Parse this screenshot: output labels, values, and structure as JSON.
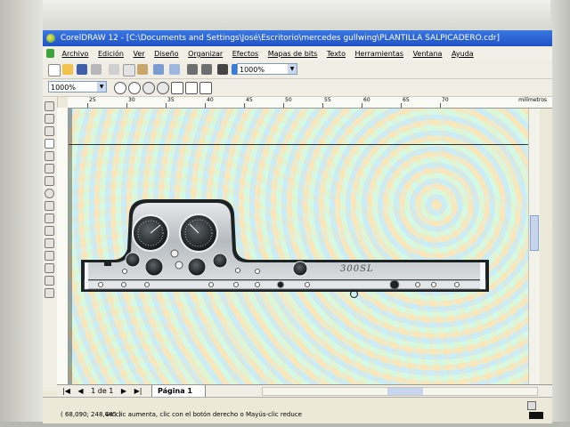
{
  "window": {
    "title": "CorelDRAW 12 - [C:\\Documents and Settings\\José\\Escritorio\\mercedes gullwing\\PLANTILLA SALPICADERO.cdr]"
  },
  "menu": {
    "items": [
      "Archivo",
      "Edición",
      "Ver",
      "Diseño",
      "Organizar",
      "Efectos",
      "Mapas de bits",
      "Texto",
      "Herramientas",
      "Ventana",
      "Ayuda"
    ]
  },
  "toolbar": {
    "zoom_value": "1000%",
    "zoom_level_value": "1000%"
  },
  "ruler": {
    "ticks": [
      "25",
      "30",
      "35",
      "40",
      "45",
      "50",
      "55",
      "60",
      "65",
      "70"
    ],
    "units": "milímetros"
  },
  "navigator": {
    "page_count": "1 de 1",
    "page_tab": "Página 1"
  },
  "status": {
    "coords": "( 68,090; 248,445 )",
    "hint": "Un clic aumenta, clic con el botón derecho o Mayús-clic reduce"
  },
  "dashboard": {
    "badge_text": "300SL"
  },
  "colors": {
    "title_bar": "#1f52c8",
    "dash_metal": "#c9cccf",
    "dash_dark": "#1d2224",
    "chrome": "#dfe3e6"
  },
  "palette": [
    "#ffffff",
    "#000000",
    "#00a0e9",
    "#00aeef",
    "#00ffff",
    "#2e8b57",
    "#009b4d",
    "#66cc33",
    "#ccff66",
    "#ffff00",
    "#ffcc00",
    "#ff9900",
    "#ff6600",
    "#ff0000",
    "#e60073",
    "#cc0099",
    "#990099",
    "#663399",
    "#3333cc",
    "#0066ff",
    "#3399ff",
    "#66ccff",
    "#99ffcc",
    "#cccccc",
    "#999999",
    "#666666",
    "#333333",
    "#996633",
    "#cc9966",
    "#ffcc99"
  ]
}
